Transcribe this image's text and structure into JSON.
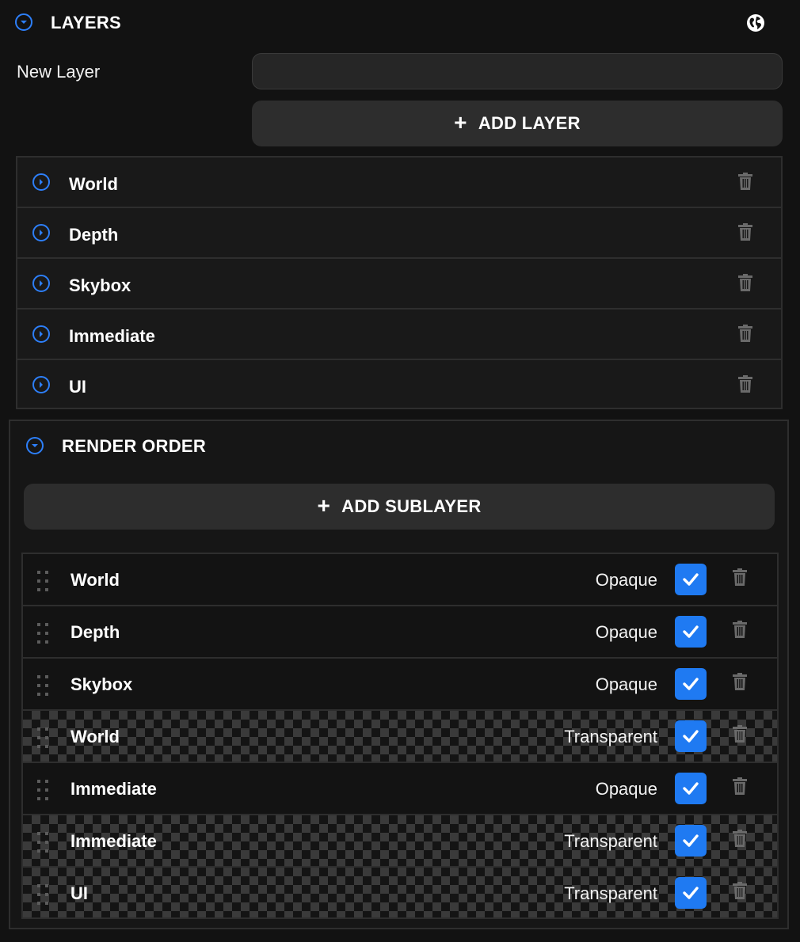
{
  "layers_panel": {
    "title": "LAYERS",
    "new_layer_label": "New Layer",
    "new_layer_value": "",
    "add_layer_label": "ADD LAYER",
    "items": [
      {
        "label": "World"
      },
      {
        "label": "Depth"
      },
      {
        "label": "Skybox"
      },
      {
        "label": "Immediate"
      },
      {
        "label": "UI"
      }
    ]
  },
  "render_order": {
    "title": "RENDER ORDER",
    "add_sublayer_label": "ADD SUBLAYER",
    "items": [
      {
        "label": "World",
        "mode": "Opaque",
        "enabled": true
      },
      {
        "label": "Depth",
        "mode": "Opaque",
        "enabled": true
      },
      {
        "label": "Skybox",
        "mode": "Opaque",
        "enabled": true
      },
      {
        "label": "World",
        "mode": "Transparent",
        "enabled": true
      },
      {
        "label": "Immediate",
        "mode": "Opaque",
        "enabled": true
      },
      {
        "label": "Immediate",
        "mode": "Transparent",
        "enabled": true
      },
      {
        "label": "UI",
        "mode": "Transparent",
        "enabled": true
      }
    ]
  },
  "icons": {
    "collapse": "chevron-down-circle-icon",
    "expand": "chevron-right-circle-icon",
    "globe": "globe-icon",
    "delete": "trash-icon",
    "drag": "drag-handle-icon",
    "add": "plus-icon",
    "check": "checkmark-icon"
  },
  "colors": {
    "background": "#121212",
    "accent": "#2d7ff9",
    "checkbox": "#1f7af2",
    "button": "#2d2d2d",
    "border": "#2e2e2e",
    "icon_muted": "#6a6a6a"
  }
}
